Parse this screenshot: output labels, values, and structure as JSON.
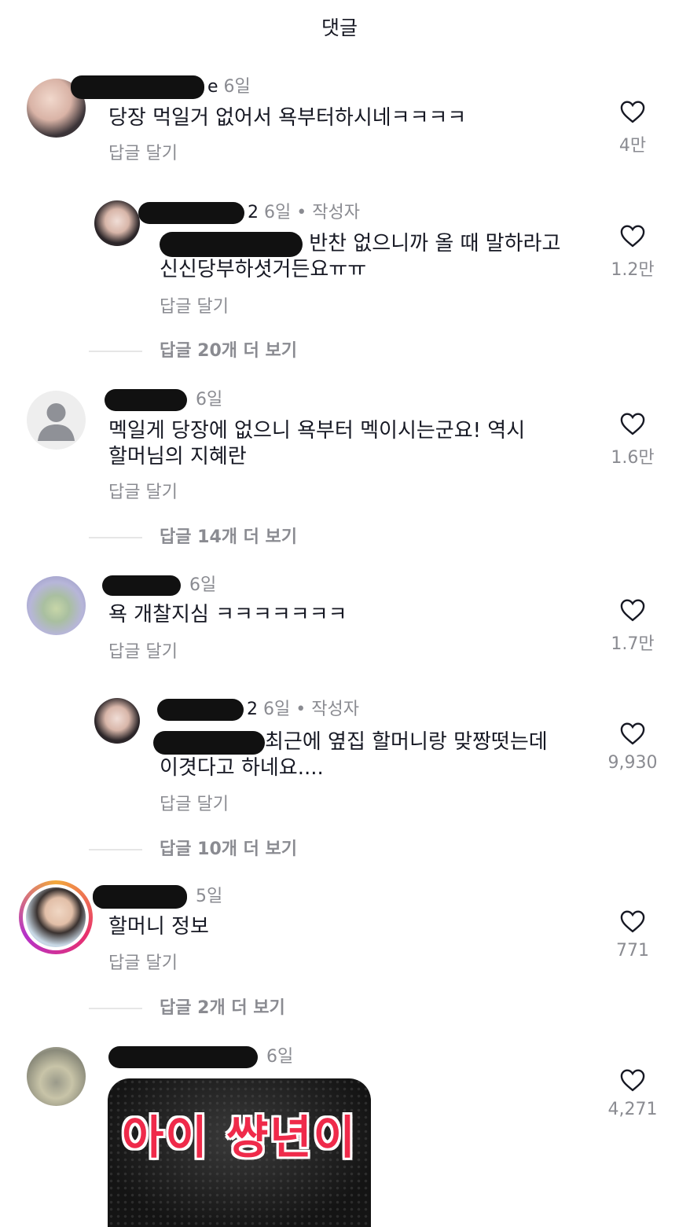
{
  "header": {
    "title": "댓글"
  },
  "reply_label": "답글 달기",
  "comments": [
    {
      "time": "6일",
      "name_tail": "e",
      "text": "당장 먹일거 없어서 욕부터하시네ㅋㅋㅋㅋ",
      "likes": "4만"
    },
    {
      "time": "6일",
      "name_tail": "2",
      "author_badge": "작성자",
      "text_line1": "반찬 없으니까 올 때 말하라고",
      "text_line2": "신신당부하셧거든요ㅠㅠ",
      "likes": "1.2만",
      "more": "답글 20개 더 보기"
    },
    {
      "time": "6일",
      "text_line1": "멕일게 당장에 없으니 욕부터 멕이시는군요! 역시",
      "text_line2": "할머님의 지혜란",
      "likes": "1.6만",
      "more": "답글 14개 더 보기"
    },
    {
      "time": "6일",
      "text": "욕 개찰지심 ㅋㅋㅋㅋㅋㅋㅋ",
      "likes": "1.7만"
    },
    {
      "time": "6일",
      "name_tail": "2",
      "author_badge": "작성자",
      "text_line1": "최근에 옆집 할머니랑 맞짱떳는데",
      "text_line2": "이겻다고 하네요....",
      "likes": "9,930",
      "more": "답글 10개 더 보기"
    },
    {
      "time": "5일",
      "text": "할머니 정보",
      "likes": "771",
      "more": "답글 2개 더 보기"
    },
    {
      "time": "6일",
      "sticker_text": "아이 썅년이",
      "likes": "4,271"
    }
  ],
  "colors": {
    "text": "#161823",
    "muted": "#8a8b91",
    "sticker_red": "#ef2a4a"
  }
}
